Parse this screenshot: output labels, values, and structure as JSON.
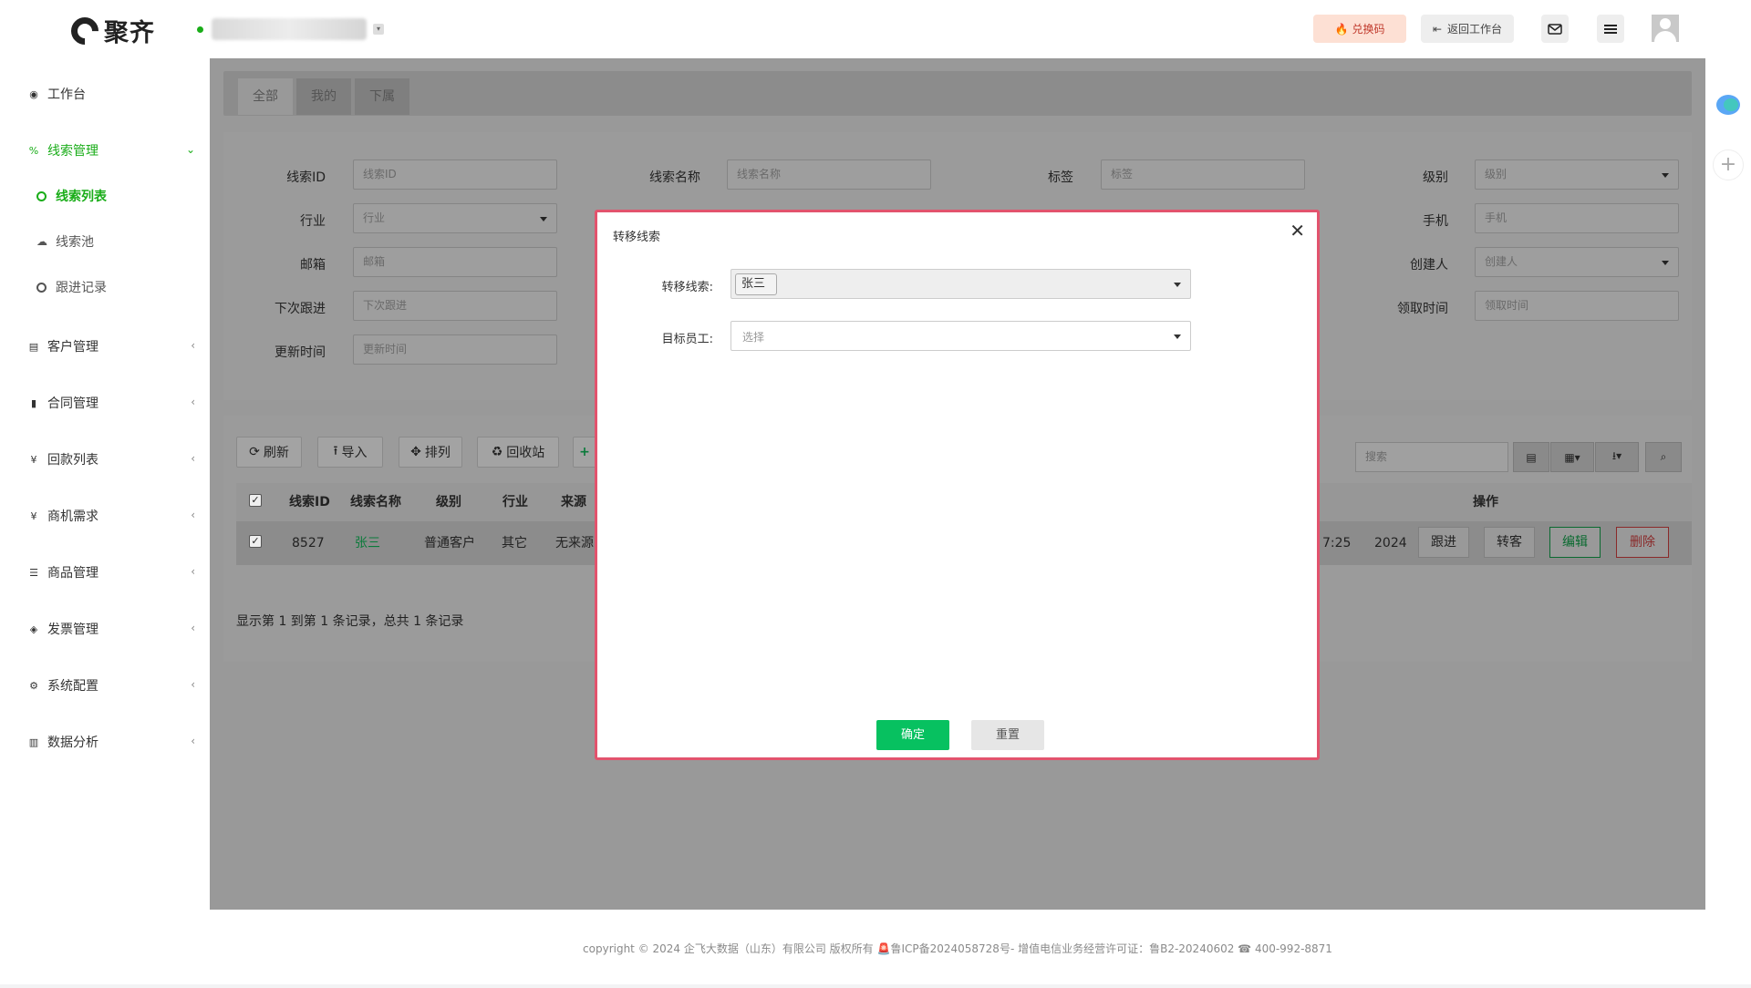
{
  "header": {
    "logo_text": "聚齐",
    "redeem_label": "兑换码",
    "back_label": "返回工作台"
  },
  "sidebar": {
    "items": [
      {
        "label": "工作台"
      },
      {
        "label": "线索管理"
      },
      {
        "label": "客户管理"
      },
      {
        "label": "合同管理"
      },
      {
        "label": "回款列表"
      },
      {
        "label": "商机需求"
      },
      {
        "label": "商品管理"
      },
      {
        "label": "发票管理"
      },
      {
        "label": "系统配置"
      },
      {
        "label": "数据分析"
      }
    ],
    "sub_items": [
      {
        "label": "线索列表"
      },
      {
        "label": "线索池"
      },
      {
        "label": "跟进记录"
      }
    ]
  },
  "tabs": [
    "全部",
    "我的",
    "下属"
  ],
  "filters": {
    "lead_id": {
      "label": "线索ID",
      "placeholder": "线索ID"
    },
    "lead_name": {
      "label": "线索名称",
      "placeholder": "线索名称"
    },
    "tag": {
      "label": "标签",
      "placeholder": "标签"
    },
    "level": {
      "label": "级别",
      "placeholder": "级别"
    },
    "industry": {
      "label": "行业",
      "placeholder": "行业"
    },
    "phone": {
      "label": "手机",
      "placeholder": "手机"
    },
    "email": {
      "label": "邮箱",
      "placeholder": "邮箱"
    },
    "creator": {
      "label": "创建人",
      "placeholder": "创建人"
    },
    "next_follow": {
      "label": "下次跟进",
      "placeholder": "下次跟进"
    },
    "claim_time": {
      "label": "领取时间",
      "placeholder": "领取时间"
    },
    "update_time": {
      "label": "更新时间",
      "placeholder": "更新时间"
    }
  },
  "toolbar": {
    "refresh": "刷新",
    "import": "导入",
    "arrange": "排列",
    "recycle": "回收站",
    "search_placeholder": "搜索"
  },
  "table": {
    "headers": [
      "线索ID",
      "线索名称",
      "级别",
      "行业",
      "来源",
      "操作"
    ],
    "row": {
      "id": "8527",
      "name": "张三",
      "level": "普通客户",
      "industry": "其它",
      "source": "无来源",
      "time_partial": "7:25",
      "year_partial": "2024"
    },
    "actions": [
      "跟进",
      "转客",
      "编辑",
      "删除"
    ]
  },
  "pager_text": "显示第 1 到第 1 条记录，总共 1 条记录",
  "footer_text": "copyright © 2024 企飞大数据（山东）有限公司 版权所有 🚨鲁ICP备2024058728号-  增值电信业务经营许可证：鲁B2-20240602 ☎ 400-992-8871",
  "dialog": {
    "title": "转移线索",
    "lead_label": "转移线索:",
    "lead_value": "张三",
    "employee_label": "目标员工:",
    "employee_placeholder": "选择",
    "confirm": "确定",
    "reset": "重置"
  },
  "colors": {
    "brand_green": "#07c160",
    "dialog_border": "#e2536d",
    "delete_red": "#e74c3c"
  }
}
